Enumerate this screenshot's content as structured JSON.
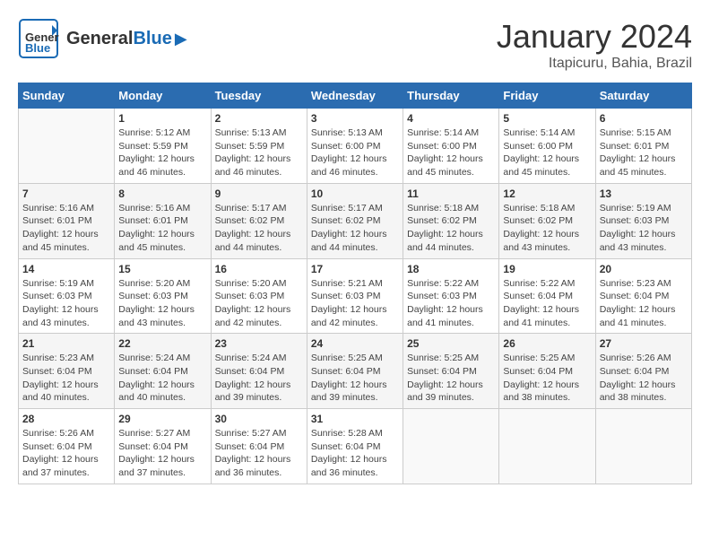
{
  "header": {
    "logo_general": "General",
    "logo_blue": "Blue",
    "title": "January 2024",
    "location": "Itapicuru, Bahia, Brazil"
  },
  "weekdays": [
    "Sunday",
    "Monday",
    "Tuesday",
    "Wednesday",
    "Thursday",
    "Friday",
    "Saturday"
  ],
  "weeks": [
    [
      {
        "day": "",
        "info": ""
      },
      {
        "day": "1",
        "info": "Sunrise: 5:12 AM\nSunset: 5:59 PM\nDaylight: 12 hours\nand 46 minutes."
      },
      {
        "day": "2",
        "info": "Sunrise: 5:13 AM\nSunset: 5:59 PM\nDaylight: 12 hours\nand 46 minutes."
      },
      {
        "day": "3",
        "info": "Sunrise: 5:13 AM\nSunset: 6:00 PM\nDaylight: 12 hours\nand 46 minutes."
      },
      {
        "day": "4",
        "info": "Sunrise: 5:14 AM\nSunset: 6:00 PM\nDaylight: 12 hours\nand 45 minutes."
      },
      {
        "day": "5",
        "info": "Sunrise: 5:14 AM\nSunset: 6:00 PM\nDaylight: 12 hours\nand 45 minutes."
      },
      {
        "day": "6",
        "info": "Sunrise: 5:15 AM\nSunset: 6:01 PM\nDaylight: 12 hours\nand 45 minutes."
      }
    ],
    [
      {
        "day": "7",
        "info": "Sunrise: 5:16 AM\nSunset: 6:01 PM\nDaylight: 12 hours\nand 45 minutes."
      },
      {
        "day": "8",
        "info": "Sunrise: 5:16 AM\nSunset: 6:01 PM\nDaylight: 12 hours\nand 45 minutes."
      },
      {
        "day": "9",
        "info": "Sunrise: 5:17 AM\nSunset: 6:02 PM\nDaylight: 12 hours\nand 44 minutes."
      },
      {
        "day": "10",
        "info": "Sunrise: 5:17 AM\nSunset: 6:02 PM\nDaylight: 12 hours\nand 44 minutes."
      },
      {
        "day": "11",
        "info": "Sunrise: 5:18 AM\nSunset: 6:02 PM\nDaylight: 12 hours\nand 44 minutes."
      },
      {
        "day": "12",
        "info": "Sunrise: 5:18 AM\nSunset: 6:02 PM\nDaylight: 12 hours\nand 43 minutes."
      },
      {
        "day": "13",
        "info": "Sunrise: 5:19 AM\nSunset: 6:03 PM\nDaylight: 12 hours\nand 43 minutes."
      }
    ],
    [
      {
        "day": "14",
        "info": "Sunrise: 5:19 AM\nSunset: 6:03 PM\nDaylight: 12 hours\nand 43 minutes."
      },
      {
        "day": "15",
        "info": "Sunrise: 5:20 AM\nSunset: 6:03 PM\nDaylight: 12 hours\nand 43 minutes."
      },
      {
        "day": "16",
        "info": "Sunrise: 5:20 AM\nSunset: 6:03 PM\nDaylight: 12 hours\nand 42 minutes."
      },
      {
        "day": "17",
        "info": "Sunrise: 5:21 AM\nSunset: 6:03 PM\nDaylight: 12 hours\nand 42 minutes."
      },
      {
        "day": "18",
        "info": "Sunrise: 5:22 AM\nSunset: 6:03 PM\nDaylight: 12 hours\nand 41 minutes."
      },
      {
        "day": "19",
        "info": "Sunrise: 5:22 AM\nSunset: 6:04 PM\nDaylight: 12 hours\nand 41 minutes."
      },
      {
        "day": "20",
        "info": "Sunrise: 5:23 AM\nSunset: 6:04 PM\nDaylight: 12 hours\nand 41 minutes."
      }
    ],
    [
      {
        "day": "21",
        "info": "Sunrise: 5:23 AM\nSunset: 6:04 PM\nDaylight: 12 hours\nand 40 minutes."
      },
      {
        "day": "22",
        "info": "Sunrise: 5:24 AM\nSunset: 6:04 PM\nDaylight: 12 hours\nand 40 minutes."
      },
      {
        "day": "23",
        "info": "Sunrise: 5:24 AM\nSunset: 6:04 PM\nDaylight: 12 hours\nand 39 minutes."
      },
      {
        "day": "24",
        "info": "Sunrise: 5:25 AM\nSunset: 6:04 PM\nDaylight: 12 hours\nand 39 minutes."
      },
      {
        "day": "25",
        "info": "Sunrise: 5:25 AM\nSunset: 6:04 PM\nDaylight: 12 hours\nand 39 minutes."
      },
      {
        "day": "26",
        "info": "Sunrise: 5:25 AM\nSunset: 6:04 PM\nDaylight: 12 hours\nand 38 minutes."
      },
      {
        "day": "27",
        "info": "Sunrise: 5:26 AM\nSunset: 6:04 PM\nDaylight: 12 hours\nand 38 minutes."
      }
    ],
    [
      {
        "day": "28",
        "info": "Sunrise: 5:26 AM\nSunset: 6:04 PM\nDaylight: 12 hours\nand 37 minutes."
      },
      {
        "day": "29",
        "info": "Sunrise: 5:27 AM\nSunset: 6:04 PM\nDaylight: 12 hours\nand 37 minutes."
      },
      {
        "day": "30",
        "info": "Sunrise: 5:27 AM\nSunset: 6:04 PM\nDaylight: 12 hours\nand 36 minutes."
      },
      {
        "day": "31",
        "info": "Sunrise: 5:28 AM\nSunset: 6:04 PM\nDaylight: 12 hours\nand 36 minutes."
      },
      {
        "day": "",
        "info": ""
      },
      {
        "day": "",
        "info": ""
      },
      {
        "day": "",
        "info": ""
      }
    ]
  ]
}
